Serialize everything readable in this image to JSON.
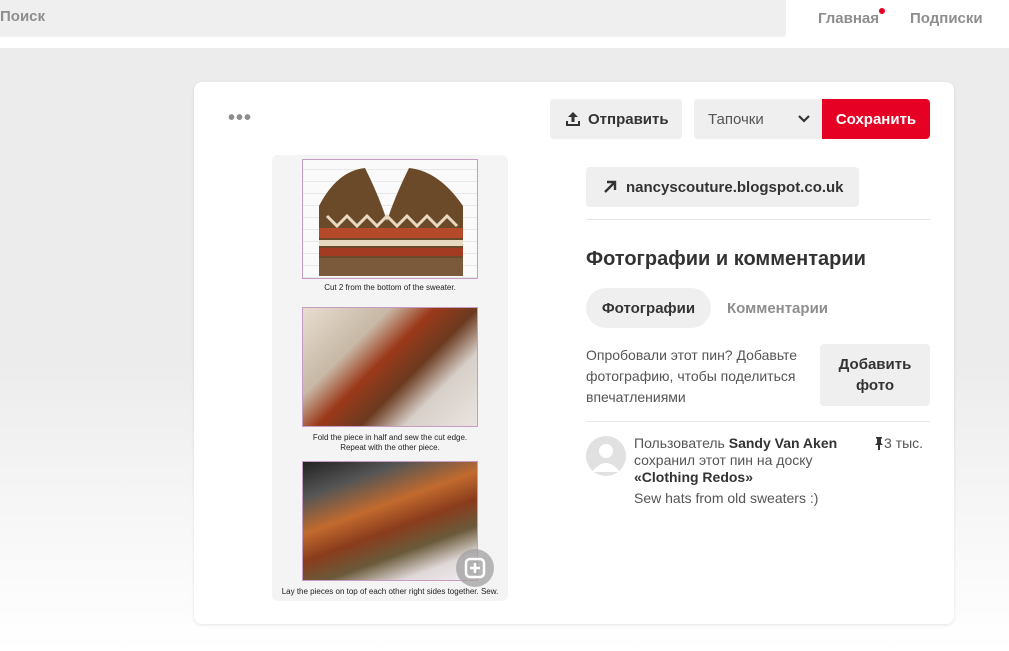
{
  "header": {
    "search_label": "Поиск",
    "nav_home": "Главная",
    "nav_following": "Подписки",
    "notification_color": "#e60023"
  },
  "toolbar": {
    "more_label": "•••",
    "send_label": "Отправить",
    "board_value": "Тапочки",
    "save_label": "Сохранить",
    "save_color": "#e60023"
  },
  "pin": {
    "captions": [
      "Cut 2 from the bottom of the sweater.",
      "Fold the piece in half and sew the cut edge.",
      "Repeat with the other piece.",
      "Lay the pieces on top of each other right sides together. Sew."
    ]
  },
  "details": {
    "source_link": "nancyscouture.blogspot.co.uk",
    "section_title": "Фотографии и комментарии",
    "tab_photos": "Фотографии",
    "tab_comments": "Комментарии",
    "try_text": "Опробовали этот пин? Добавьте фотографию, чтобы поделиться впечатлениями",
    "add_photo_line1": "Добавить",
    "add_photo_line2": "фото",
    "saved_prefix": "Пользователь",
    "saved_user": "Sandy Van Aken",
    "saved_middle": "сохранил этот пин на доску",
    "saved_board": "«Clothing Redos»",
    "save_count": "3 тыс.",
    "description": "Sew hats from old sweaters :)"
  }
}
